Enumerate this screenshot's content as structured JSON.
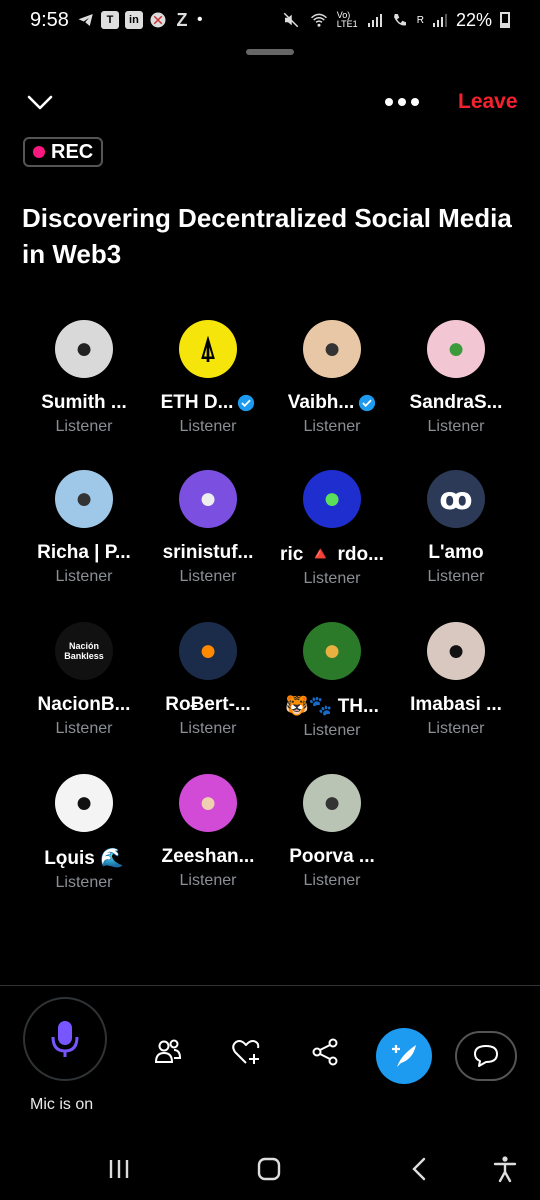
{
  "status_bar": {
    "time": "9:58",
    "notification_icons": [
      "telegram-icon",
      "teams-icon",
      "linkedin-icon",
      "app-icon",
      "z-icon"
    ],
    "dot": "•",
    "network": "Vo) LTE1",
    "sim2": "R",
    "battery": "22%"
  },
  "header": {
    "leave_label": "Leave"
  },
  "recording": {
    "label": "REC"
  },
  "space": {
    "title": "Discovering Decentralized Social Media in Web3"
  },
  "participants": [
    {
      "name": "Sumith ...",
      "role": "Listener",
      "verified": false,
      "avatar_color": "#d9d9d9",
      "avatar_fg": "#222",
      "avatar_glyph": "●"
    },
    {
      "name": "ETH D...",
      "role": "Listener",
      "verified": true,
      "avatar_color": "#f5e50b",
      "avatar_fg": "#000",
      "avatar_glyph": "⍋"
    },
    {
      "name": "Vaibh...",
      "role": "Listener",
      "verified": true,
      "avatar_color": "#e8c7a6",
      "avatar_fg": "#333",
      "avatar_glyph": "●"
    },
    {
      "name": "SandraS...",
      "role": "Listener",
      "verified": false,
      "avatar_color": "#f2c6d3",
      "avatar_fg": "#3b9b3b",
      "avatar_glyph": "●"
    },
    {
      "name": "Richa | P...",
      "role": "Listener",
      "verified": false,
      "avatar_color": "#9fc8e8",
      "avatar_fg": "#333",
      "avatar_glyph": "●"
    },
    {
      "name": "srinistuf...",
      "role": "Listener",
      "verified": false,
      "avatar_color": "#7b4fe0",
      "avatar_fg": "#eee",
      "avatar_glyph": "●"
    },
    {
      "name": "ric 🔺 rdo...",
      "role": "Listener",
      "verified": false,
      "avatar_color": "#1f2ecf",
      "avatar_fg": "#5be05b",
      "avatar_glyph": "●"
    },
    {
      "name": "L'amo",
      "role": "Listener",
      "verified": false,
      "avatar_color": "#2c3a57",
      "avatar_fg": "#fff",
      "avatar_glyph": "ꝏ"
    },
    {
      "name": "NacionB...",
      "role": "Listener",
      "verified": false,
      "avatar_color": "#111111",
      "avatar_fg": "#fff",
      "avatar_glyph": "Nación Bankless"
    },
    {
      "name": "RoɃert-...",
      "role": "Listener",
      "verified": false,
      "avatar_color": "#1b2c4a",
      "avatar_fg": "#ff8a00",
      "avatar_glyph": "●"
    },
    {
      "name": "🐯🐾 TH...",
      "role": "Listener",
      "verified": false,
      "avatar_color": "#2a7a2a",
      "avatar_fg": "#e8b040",
      "avatar_glyph": "●"
    },
    {
      "name": "Imabasi ...",
      "role": "Listener",
      "verified": false,
      "avatar_color": "#d8c8c0",
      "avatar_fg": "#111",
      "avatar_glyph": "●"
    },
    {
      "name": "Lǫuis 🌊",
      "role": "Listener",
      "verified": false,
      "avatar_color": "#f4f4f4",
      "avatar_fg": "#111",
      "avatar_glyph": "●"
    },
    {
      "name": "Zeeshan...",
      "role": "Listener",
      "verified": false,
      "avatar_color": "#d14bd6",
      "avatar_fg": "#f0d0b0",
      "avatar_glyph": "●"
    },
    {
      "name": "Poorva ...",
      "role": "Listener",
      "verified": false,
      "avatar_color": "#b9c4b5",
      "avatar_fg": "#333",
      "avatar_glyph": "●"
    }
  ],
  "controls": {
    "mic_status": "Mic is on"
  },
  "colors": {
    "accent_blue": "#1d9bf0",
    "leave_red": "#f4212e",
    "rec_pink": "#f91880",
    "mic_purple": "#7856ff",
    "secondary_text": "#8b8f94"
  }
}
